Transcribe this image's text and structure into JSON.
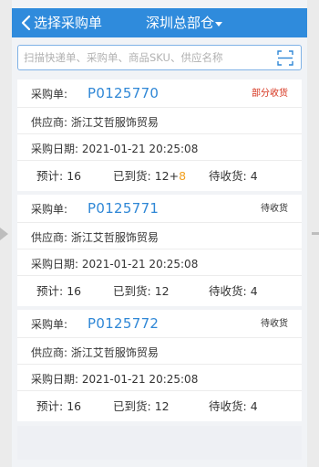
{
  "header": {
    "title": "选择采购单",
    "warehouse": "深圳总部仓"
  },
  "search": {
    "placeholder": "扫描快递单、采购单、商品SKU、供应名称",
    "value": ""
  },
  "labels": {
    "po": "采购单:",
    "supplier": "供应商:",
    "date": "采购日期:",
    "expected": "预计:",
    "received": "已到货:",
    "pending": "待收货:"
  },
  "orders": [
    {
      "po_number": "P0125770",
      "status": "部分收货",
      "supplier": "浙江艾哲服饰贸易",
      "date": "2021-01-21 20:25:08",
      "expected": "16",
      "received": "12",
      "received_extra": "8",
      "pending": "4"
    },
    {
      "po_number": "P0125771",
      "status": "待收货",
      "supplier": "浙江艾哲服饰贸易",
      "date": "2021-01-21 20:25:08",
      "expected": "16",
      "received": "12",
      "pending": "4"
    },
    {
      "po_number": "P0125772",
      "status": "待收货",
      "supplier": "浙江艾哲服饰贸易",
      "date": "2021-01-21 20:25:08",
      "expected": "16",
      "received": "12",
      "pending": "4"
    }
  ],
  "colors": {
    "header_bg": "#2f8bdc",
    "po_number": "#2f87d6",
    "status_partial": "#d6341e",
    "received_extra": "#f2a01e",
    "page_bg": "#f1f3f6"
  },
  "icons": {
    "back": "chevron-left-icon",
    "dropdown": "caret-down-icon",
    "scan": "scan-icon"
  }
}
